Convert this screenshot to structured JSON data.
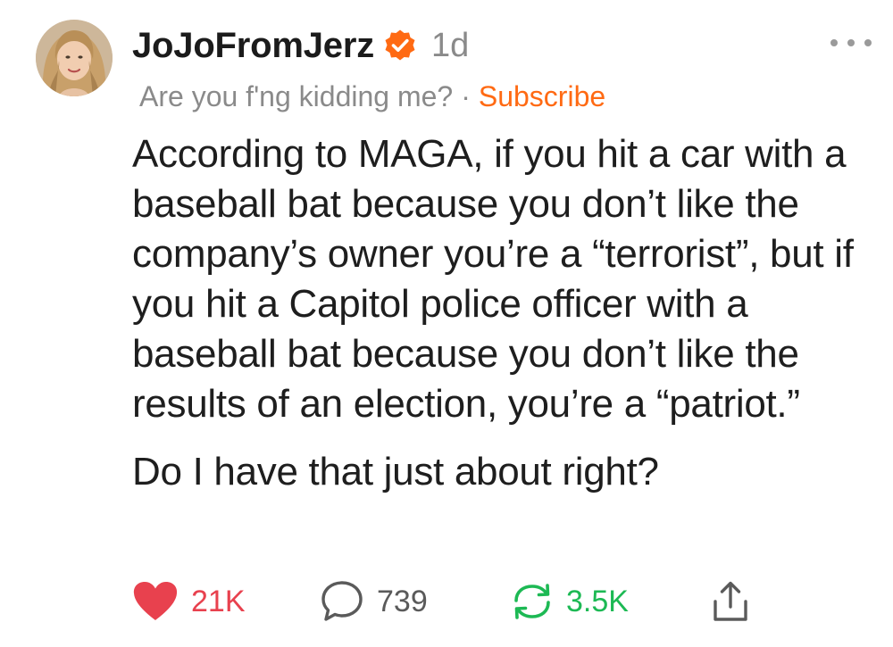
{
  "post": {
    "author": {
      "name": "JoJoFromJerz",
      "verified": true,
      "avatar_icon": "profile-photo-avatar"
    },
    "timestamp": "1d",
    "publication": "Are you f'ng kidding me?",
    "separator": "·",
    "subscribe_label": "Subscribe",
    "more_icon": "ellipsis-icon",
    "body": {
      "paragraph_1": "According to MAGA, if you hit a car with a baseball bat because you don’t like the company’s owner you’re a “terrorist”, but if you hit a Capitol police officer with a baseball bat because you don’t like the results of an election, you’re a “patriot.”",
      "paragraph_2": "Do I have that just about right?"
    },
    "actions": {
      "like_count": "21K",
      "comment_count": "739",
      "restack_count": "3.5K",
      "like_icon": "heart-icon",
      "comment_icon": "speech-bubble-icon",
      "restack_icon": "restack-arrows-icon",
      "share_icon": "share-icon"
    },
    "colors": {
      "accent": "#ff6a13",
      "like": "#e8414e",
      "restack": "#1db954",
      "secondary_text": "#8a8a8a",
      "body_text": "#1e1e1e"
    }
  }
}
